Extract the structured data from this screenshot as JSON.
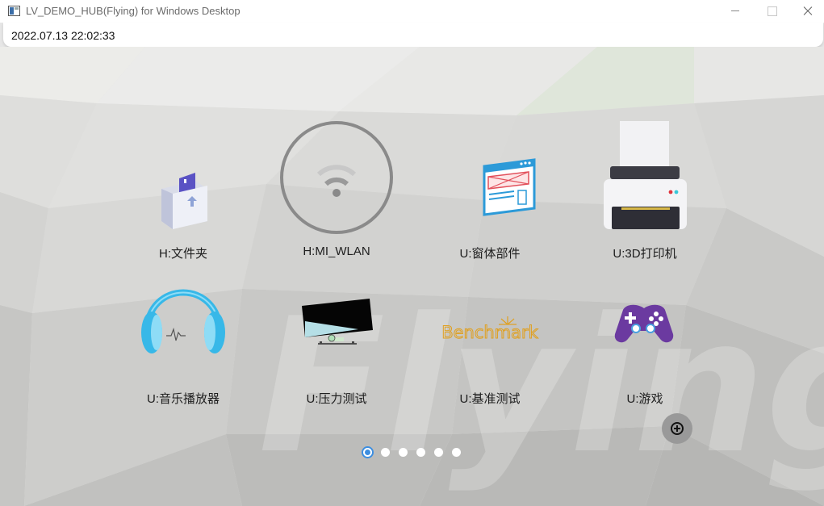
{
  "window": {
    "title": "LV_DEMO_HUB(Flying) for Windows Desktop",
    "icon": "app-window-icon"
  },
  "status": {
    "datetime": "2022.07.13 22:02:33"
  },
  "watermark": "Flying",
  "apps": [
    {
      "label": "H:文件夹",
      "icon": "folder-icon"
    },
    {
      "label": "H:MI_WLAN",
      "icon": "wifi-icon"
    },
    {
      "label": "U:窗体部件",
      "icon": "widgets-window-icon"
    },
    {
      "label": "U:3D打印机",
      "icon": "printer-icon"
    },
    {
      "label": "U:音乐播放器",
      "icon": "headphones-icon"
    },
    {
      "label": "U:压力测试",
      "icon": "stress-test-icon"
    },
    {
      "label": "U:基准测试",
      "icon": "benchmark-icon",
      "logo_text": "Benchmark"
    },
    {
      "label": "U:游戏",
      "icon": "gamepad-icon"
    }
  ],
  "pager": {
    "page_count": 6,
    "active_index": 0
  },
  "colors": {
    "accent": "#3d8ee0",
    "add_button": "#999999",
    "benchmark_gold": "#e0a020"
  }
}
